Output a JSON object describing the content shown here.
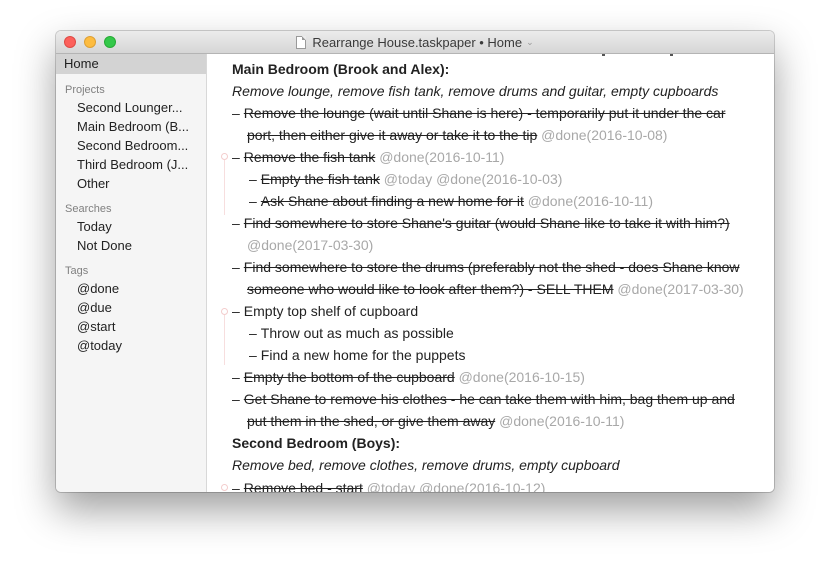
{
  "window": {
    "title": "Rearrange House.taskpaper • Home",
    "title_menu_icon": "chevron-down-icon",
    "doc_icon": "document-icon"
  },
  "sidebar": {
    "home": "Home",
    "projects_header": "Projects",
    "projects": [
      {
        "label": "Second Lounger..."
      },
      {
        "label": "Main Bedroom (B..."
      },
      {
        "label": "Second Bedroom..."
      },
      {
        "label": "Third Bedroom (J..."
      },
      {
        "label": "Other"
      }
    ],
    "searches_header": "Searches",
    "searches": [
      {
        "label": "Today"
      },
      {
        "label": "Not Done"
      }
    ],
    "tags_header": "Tags",
    "tags": [
      {
        "label": "@done"
      },
      {
        "label": "@due"
      },
      {
        "label": "@start"
      },
      {
        "label": "@today"
      }
    ]
  },
  "editor": {
    "lines": {
      "p1": "Main Bedroom (Brook and Alex):",
      "n1": "Remove lounge, remove fish tank, remove drums and guitar, empty cupboards",
      "t1a": "Remove the lounge (wait until Shane is here) - temporarily put it under the car",
      "t1b": "port, then either give it away or take it to the tip",
      "t1tag": "@done(2016-10-08)",
      "t2": "Remove the fish tank",
      "t2tag": "@done(2016-10-11)",
      "t3": "Empty the fish tank",
      "t3tag": "@today @done(2016-10-03)",
      "t4": "Ask Shane about finding a new home for it",
      "t4tag": "@done(2016-10-11)",
      "t5a": "Find somewhere to store Shane's guitar (would Shane like to take it with him?)",
      "t5tag": "@done(2017-03-30)",
      "t6a": "Find somewhere to store the drums (preferably not the shed - does Shane know",
      "t6b": "someone who would like to look after them?) - SELL THEM",
      "t6tag": "@done(2017-03-30)",
      "t7": "Empty top shelf of cupboard",
      "t8": "Throw out as much as possible",
      "t9": "Find a new home for the puppets",
      "t10": "Empty the bottom of the cupboard",
      "t10tag": "@done(2016-10-15)",
      "t11a": "Get Shane to remove his clothes - he can take them with him, bag them up and",
      "t11b": "put them in the shed, or give them away",
      "t11tag": "@done(2016-10-11)",
      "p2": "Second Bedroom (Boys):",
      "n2": "Remove bed, remove clothes, remove drums, empty cupboard",
      "t12": "Remove bed - start",
      "t12tag": "@today @done(2016-10-12)"
    },
    "dash": "–"
  }
}
